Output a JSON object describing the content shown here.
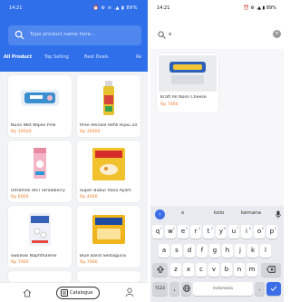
{
  "catalogue": {
    "status_time": "14:21",
    "status_icons": "⏰ ⚙ ≡ .▲ ▮ 89%",
    "search_placeholder": "Type product name here...",
    "tabs": [
      "All Product",
      "Top Selling",
      "Best Deals",
      "Re"
    ],
    "products": [
      {
        "name": "Nuvo Wet Wipes Pink",
        "price": "Rp 19500"
      },
      {
        "name": "Ifree Aerosol Refill Hijau 20",
        "price": "Rp 35000"
      },
      {
        "name": "Ultramilk UHT Strawberry",
        "price": "Rp 6000"
      },
      {
        "name": "Super Bubur Rasa Ayam",
        "price": "Rp 4000"
      },
      {
        "name": "Swallow Naphthalene",
        "price": "Rp 7000"
      },
      {
        "name": "Blue Band Serbaguna",
        "price": "Rp 7000"
      }
    ],
    "nav": {
      "home_icon": "home-icon",
      "catalogue_label": "Catalogue",
      "account_icon": "user-icon"
    },
    "colors": {
      "primary": "#2f6fea",
      "price": "#ee7b2a"
    }
  },
  "search_screen": {
    "status_time": "14:21",
    "status_icons": "⏰ ⚙ .▲ ▮ 89%",
    "query": "x",
    "result": {
      "name": "Kraft All Nons Cheese",
      "price": "Rp 7000"
    },
    "keyboard": {
      "suggestions": [
        "x",
        "kolo",
        "kemana"
      ],
      "row1": [
        "q",
        "w",
        "e",
        "r",
        "t",
        "y",
        "u",
        "i",
        "o",
        "p"
      ],
      "row1_hints": [
        "1",
        "2",
        "3",
        "4",
        "5",
        "6",
        "7",
        "8",
        "9",
        "0"
      ],
      "row2": [
        "a",
        "s",
        "d",
        "f",
        "g",
        "h",
        "j",
        "k",
        "l"
      ],
      "row3": [
        "z",
        "x",
        "c",
        "v",
        "b",
        "n",
        "m"
      ],
      "symbols_key": "?123",
      "comma_key": ",",
      "space_label": "Indonesia",
      "period_key": "."
    }
  }
}
